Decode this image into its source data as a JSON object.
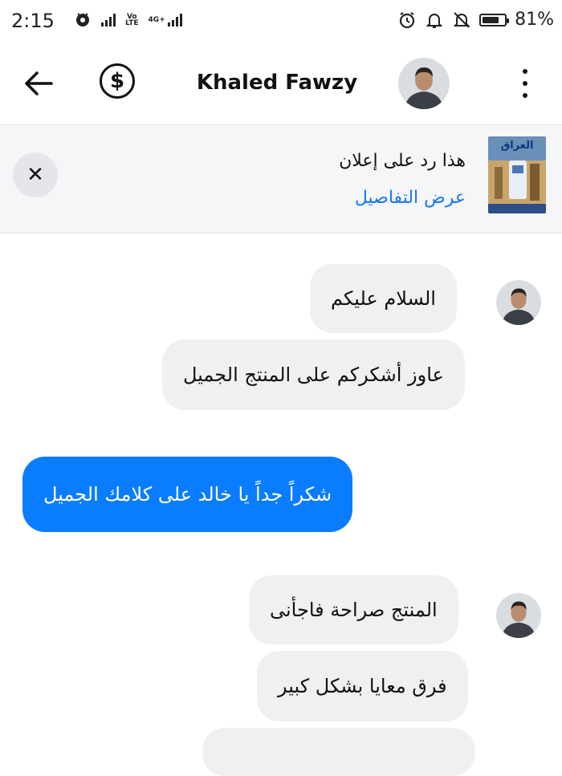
{
  "status_bar": {
    "time": "2:15",
    "battery_text": "81%",
    "battery_level": 0.81,
    "network_vo": "Vo",
    "network_lte": "LTE",
    "network_4g": "4G+"
  },
  "header": {
    "title": "Khaled Fawzy"
  },
  "ad_banner": {
    "title": "هذا رد على إعلان",
    "link": "عرض التفاصيل",
    "thumb_text": "العراق"
  },
  "messages": [
    {
      "direction": "incoming",
      "text": "السلام عليكم"
    },
    {
      "direction": "incoming",
      "text": "عاوز أشكركم على المنتج الجميل"
    },
    {
      "direction": "outgoing",
      "text": "شكراً جداً يا خالد على كلامك الجميل"
    },
    {
      "direction": "incoming",
      "text": "المنتج صراحة فاجأنى"
    },
    {
      "direction": "incoming",
      "text": "فرق معايا بشكل كبير"
    }
  ],
  "colors": {
    "accent": "#1877f2",
    "outgoing_bubble": "#0a7cff",
    "incoming_bubble": "#f0f0f0",
    "banner_bg": "#f5f6f8"
  },
  "icons": [
    "back-arrow-icon",
    "dollar-icon",
    "more-vert-icon",
    "close-icon",
    "alarm-icon",
    "bell-icon",
    "bell-off-icon",
    "battery-icon"
  ]
}
